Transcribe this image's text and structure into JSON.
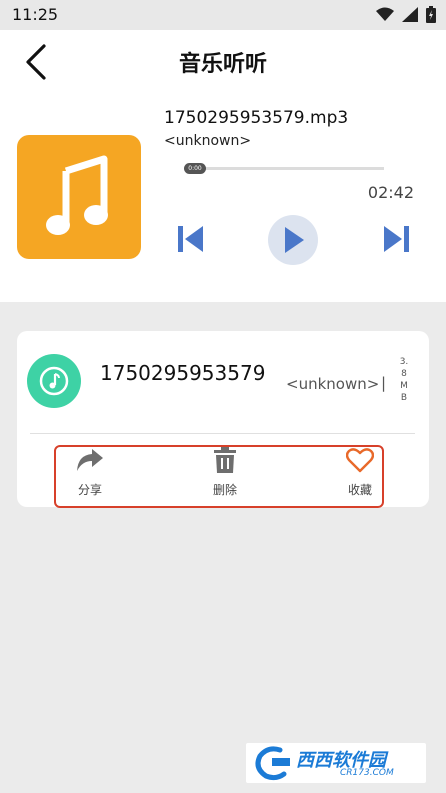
{
  "status_bar": {
    "time": "11:25"
  },
  "header": {
    "title": "音乐听听"
  },
  "player": {
    "file_name": "1750295953579.mp3",
    "artist": "<unknown>",
    "position": "0:00",
    "progress": 0,
    "duration": "02:42"
  },
  "track": {
    "title": "1750295953579",
    "artist": "<unknown>",
    "separator": "|",
    "size": "3.8MB"
  },
  "actions": {
    "share_label": "分享",
    "delete_label": "删除",
    "favorite_label": "收藏"
  },
  "watermark": {
    "text": "西西软件园",
    "sub": "CR173.COM"
  },
  "colors": {
    "accent": "#4a77c9",
    "cover": "#f5a623",
    "track_icon": "#3ed2a5",
    "highlight_border": "#d7402a",
    "favorite": "#e8692a"
  }
}
